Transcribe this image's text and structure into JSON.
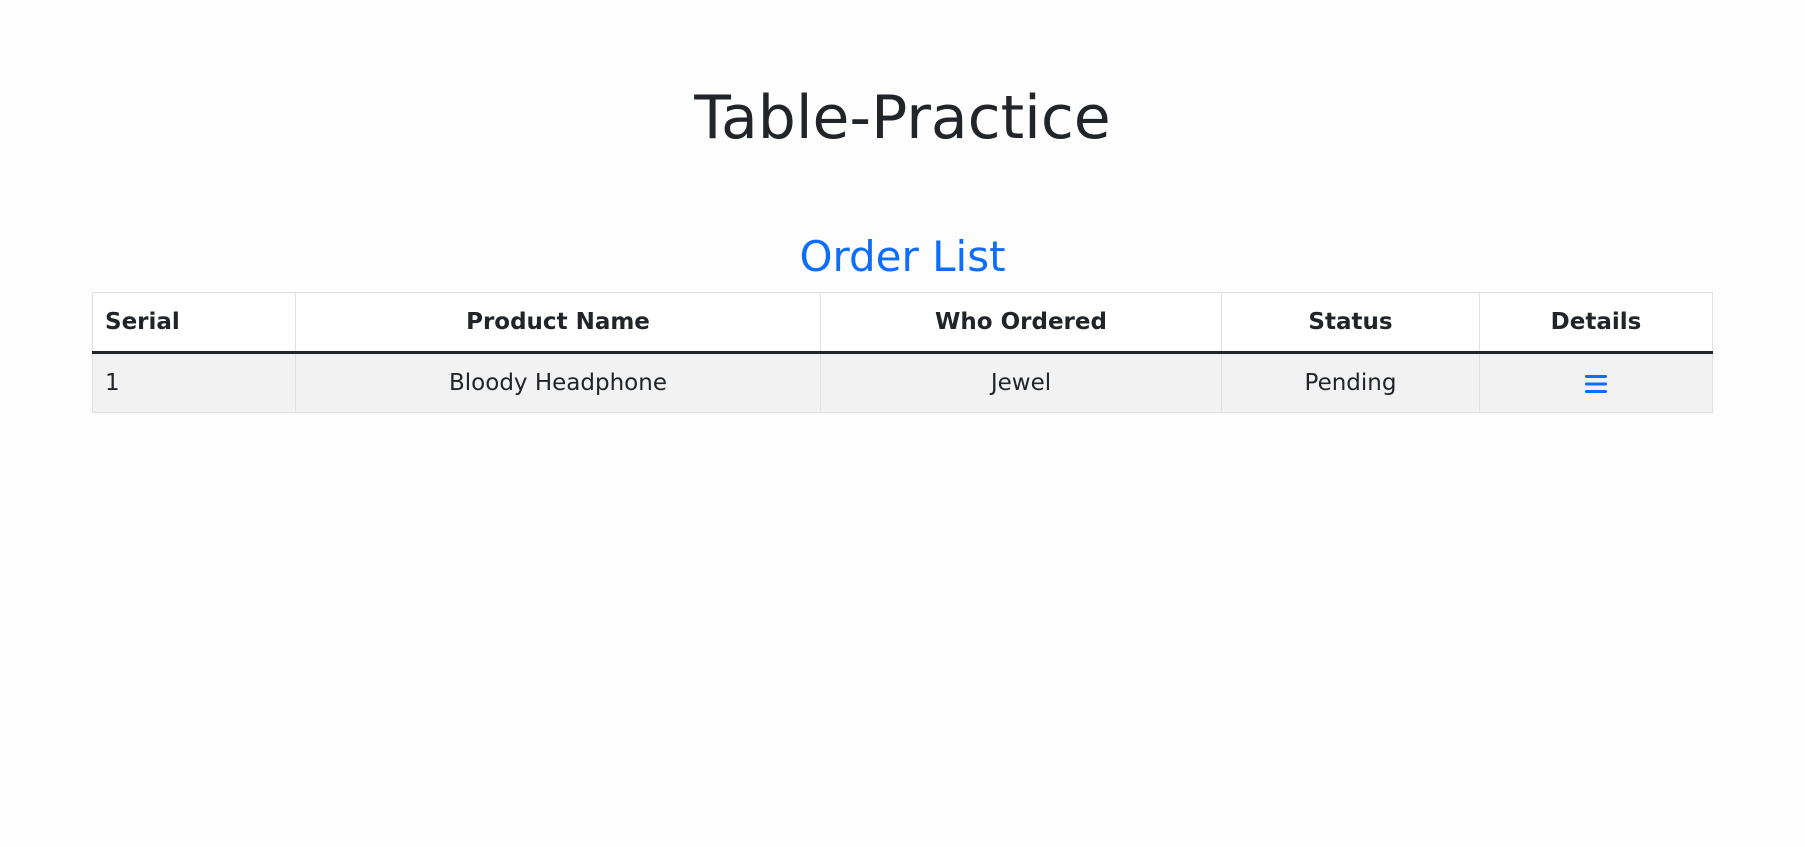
{
  "page": {
    "title": "Table-Practice"
  },
  "orders": {
    "heading": "Order List",
    "accent_color": "#0d6efd",
    "columns": [
      "Serial",
      "Product Name",
      "Who Ordered",
      "Status",
      "Details"
    ],
    "rows": [
      {
        "serial": "1",
        "product_name": "Bloody Headphone",
        "who_ordered": "Jewel",
        "status": "Pending",
        "details_icon": "menu-icon"
      }
    ]
  }
}
